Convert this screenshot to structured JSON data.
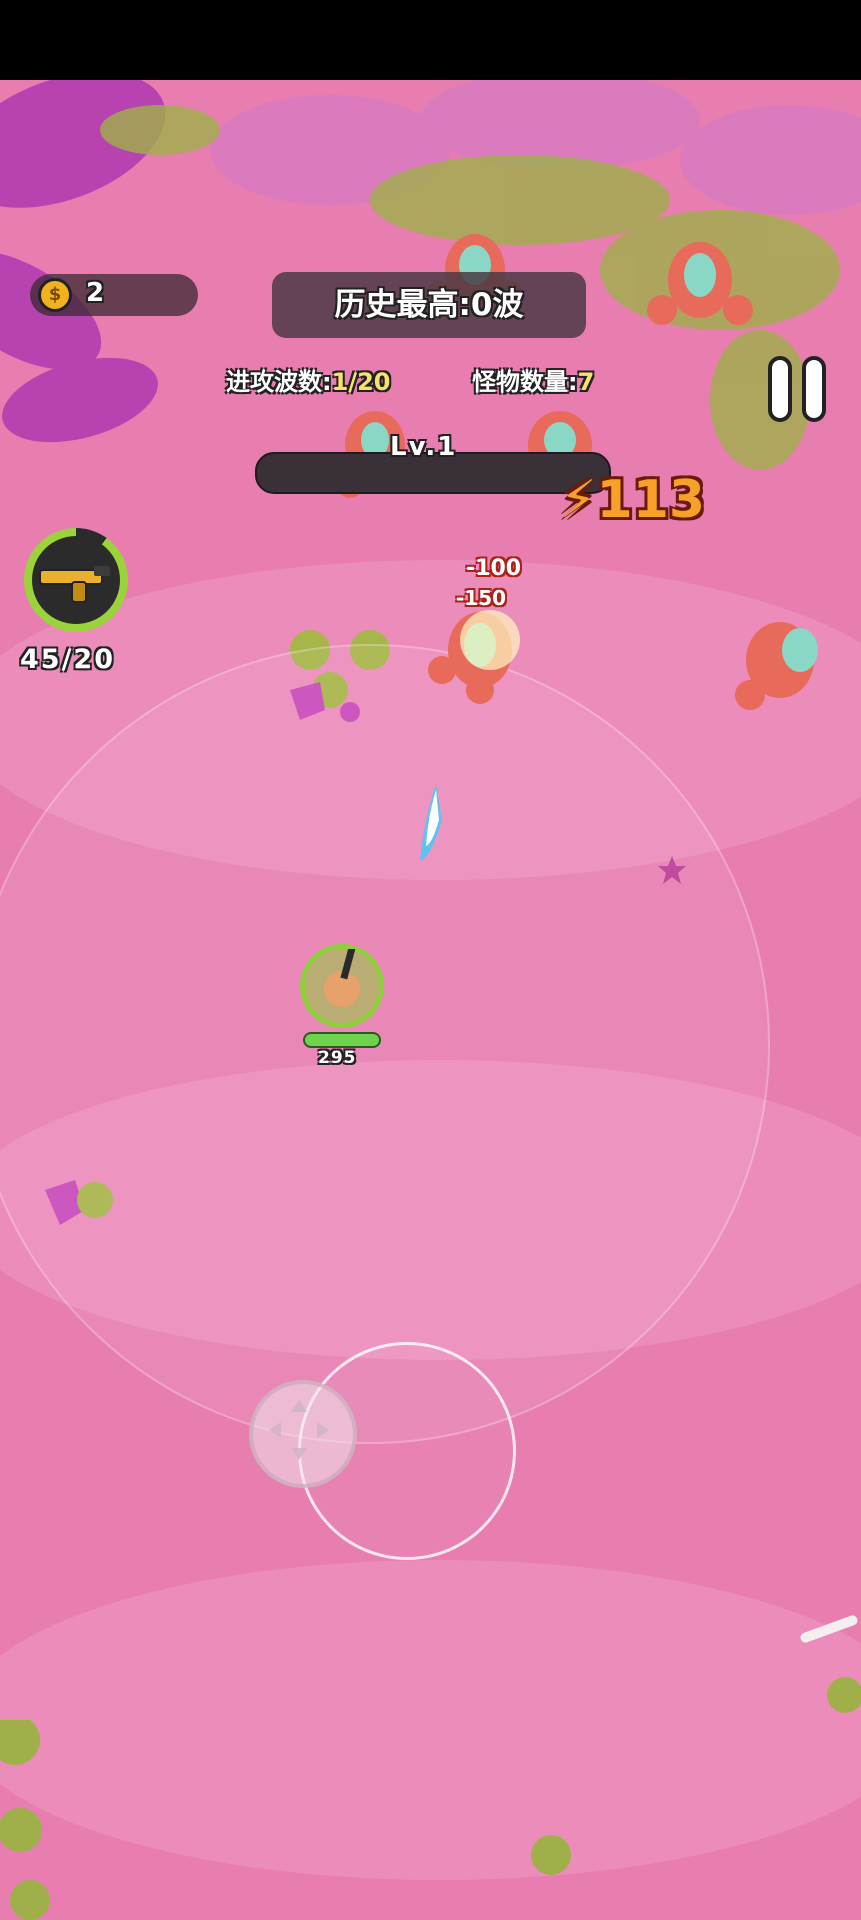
{
  "hud": {
    "coins": "2",
    "best_record": "历史最高:0波",
    "wave_label": "进攻波数:",
    "wave_value": "1/20",
    "monster_label": "怪物数量:",
    "monster_value": "7",
    "level": "Lv.1",
    "ammo": "45/20"
  },
  "combat": {
    "damage_numbers": [
      "-100",
      "-150"
    ],
    "crit_damage": "113",
    "player_hp": "295"
  },
  "icons": {
    "coin": "coin-icon",
    "pause": "pause-icon",
    "weapon": "golden-gun-icon",
    "joystick": "dpad-arrows-icon"
  },
  "colors": {
    "ground": "#e87db0",
    "accent_yellow": "#f7e36b",
    "crit_orange": "#f7a12a",
    "hp_green": "#6dd34c"
  }
}
